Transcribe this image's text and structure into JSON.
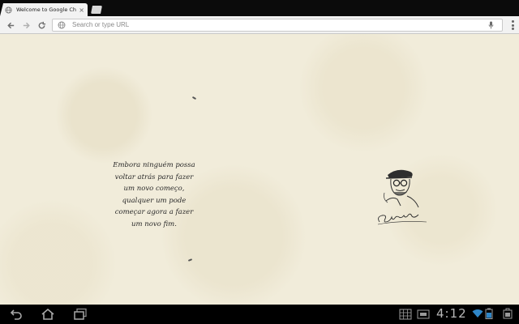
{
  "browser": {
    "tab_title": "Welcome to Google Chrome",
    "tab_close_glyph": "×",
    "omnibox_placeholder": "Search or type URL"
  },
  "icons": {
    "favicon": "globe-icon",
    "back": "back-arrow-icon",
    "forward": "forward-arrow-icon",
    "reload": "reload-icon",
    "omnibox_site": "globe-icon",
    "voice": "microphone-icon",
    "menu": "overflow-menu-icon",
    "nav_back": "back-icon",
    "nav_home": "home-icon",
    "nav_recents": "recent-apps-icon",
    "apps": "app-drawer-icon",
    "wifi": "wifi-icon",
    "battery": "battery-icon"
  },
  "page": {
    "quote_lines": [
      "Embora ninguém possa",
      "voltar atrás para fazer",
      "um novo começo,",
      "qualquer um pode",
      "começar agora a fazer",
      "um novo fim."
    ],
    "signature": "Chico Xavier"
  },
  "system_bar": {
    "clock": "4:12"
  },
  "colors": {
    "page_background": "#f1ecda",
    "tab_strip": "#0b0b0b",
    "toolbar": "#f2f2f2",
    "system_bar": "#000000",
    "clock": "#b7b7b7"
  }
}
